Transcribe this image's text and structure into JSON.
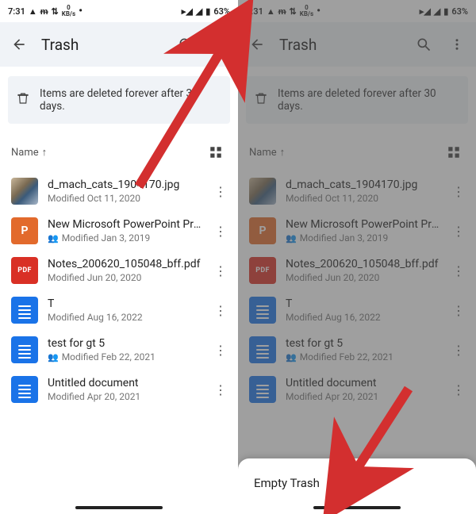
{
  "status": {
    "time": "7:31",
    "kbs_value": "0",
    "kbs_unit": "KB/s",
    "battery": "63%"
  },
  "appbar": {
    "title": "Trash"
  },
  "banner": {
    "text": "Items are deleted forever after 30 days."
  },
  "sort": {
    "label": "Name"
  },
  "files": [
    {
      "name": "d_mach_cats_1904170.jpg",
      "sub": "Modified Oct 11, 2020",
      "type": "img",
      "shared": false
    },
    {
      "name": "New Microsoft PowerPoint Presentat…",
      "sub": "Modified Jan 3, 2019",
      "type": "ppt",
      "shared": true
    },
    {
      "name": "Notes_200620_105048_bff.pdf",
      "sub": "Modified Jun 20, 2020",
      "type": "pdf",
      "shared": false
    },
    {
      "name": "T",
      "sub": "Modified Aug 16, 2022",
      "type": "doc",
      "shared": false
    },
    {
      "name": "test for gt 5",
      "sub": "Modified Feb 22, 2021",
      "type": "doc",
      "shared": true
    },
    {
      "name": "Untitled document",
      "sub": "Modified Apr 20, 2021",
      "type": "doc",
      "shared": false
    }
  ],
  "sheet": {
    "option": "Empty Trash"
  },
  "colors": {
    "banner_bg": "#f0f3f7",
    "accent_blue": "#1a73e8",
    "arrow_red": "#d32f2f"
  }
}
